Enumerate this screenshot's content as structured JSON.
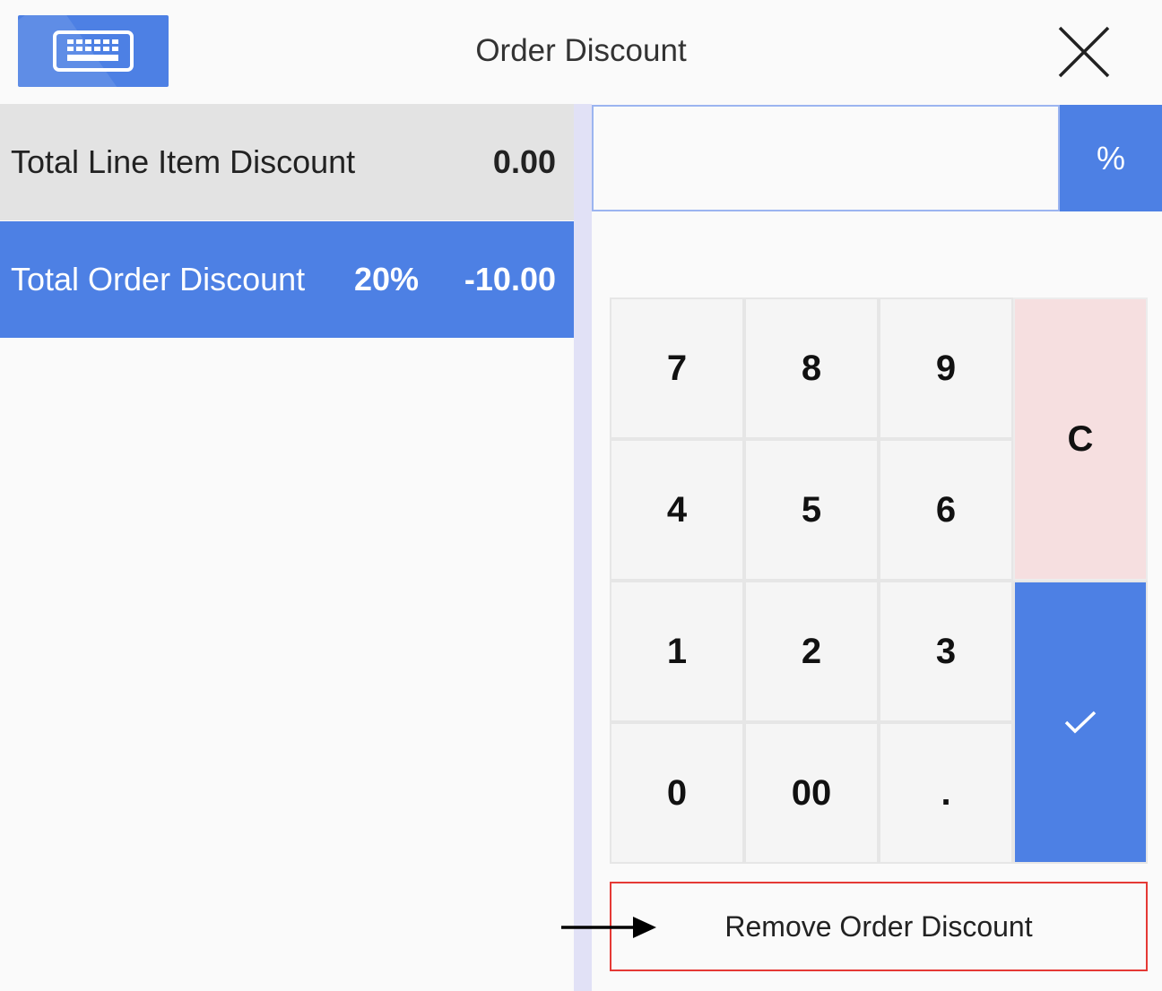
{
  "header": {
    "title": "Order Discount",
    "keyboard_icon": "keyboard-icon",
    "close_icon": "close-icon"
  },
  "summary": {
    "line_item": {
      "label": "Total Line Item Discount",
      "amount": "0.00"
    },
    "order": {
      "label": "Total Order Discount",
      "percent": "20%",
      "amount": "-10.00"
    }
  },
  "discount_input": {
    "value": "",
    "mode_label": "%"
  },
  "keypad": {
    "keys": [
      "7",
      "8",
      "9",
      "4",
      "5",
      "6",
      "1",
      "2",
      "3",
      "0",
      "00",
      "."
    ],
    "clear_label": "C",
    "confirm_icon": "check-icon"
  },
  "remove_button": {
    "label": "Remove Order Discount"
  },
  "annotation": {
    "icon": "arrow-right-icon"
  },
  "colors": {
    "accent": "#4d80e4",
    "clear_key": "#f6dfe0",
    "remove_border": "#e53935",
    "row_gray": "#e3e3e3"
  }
}
